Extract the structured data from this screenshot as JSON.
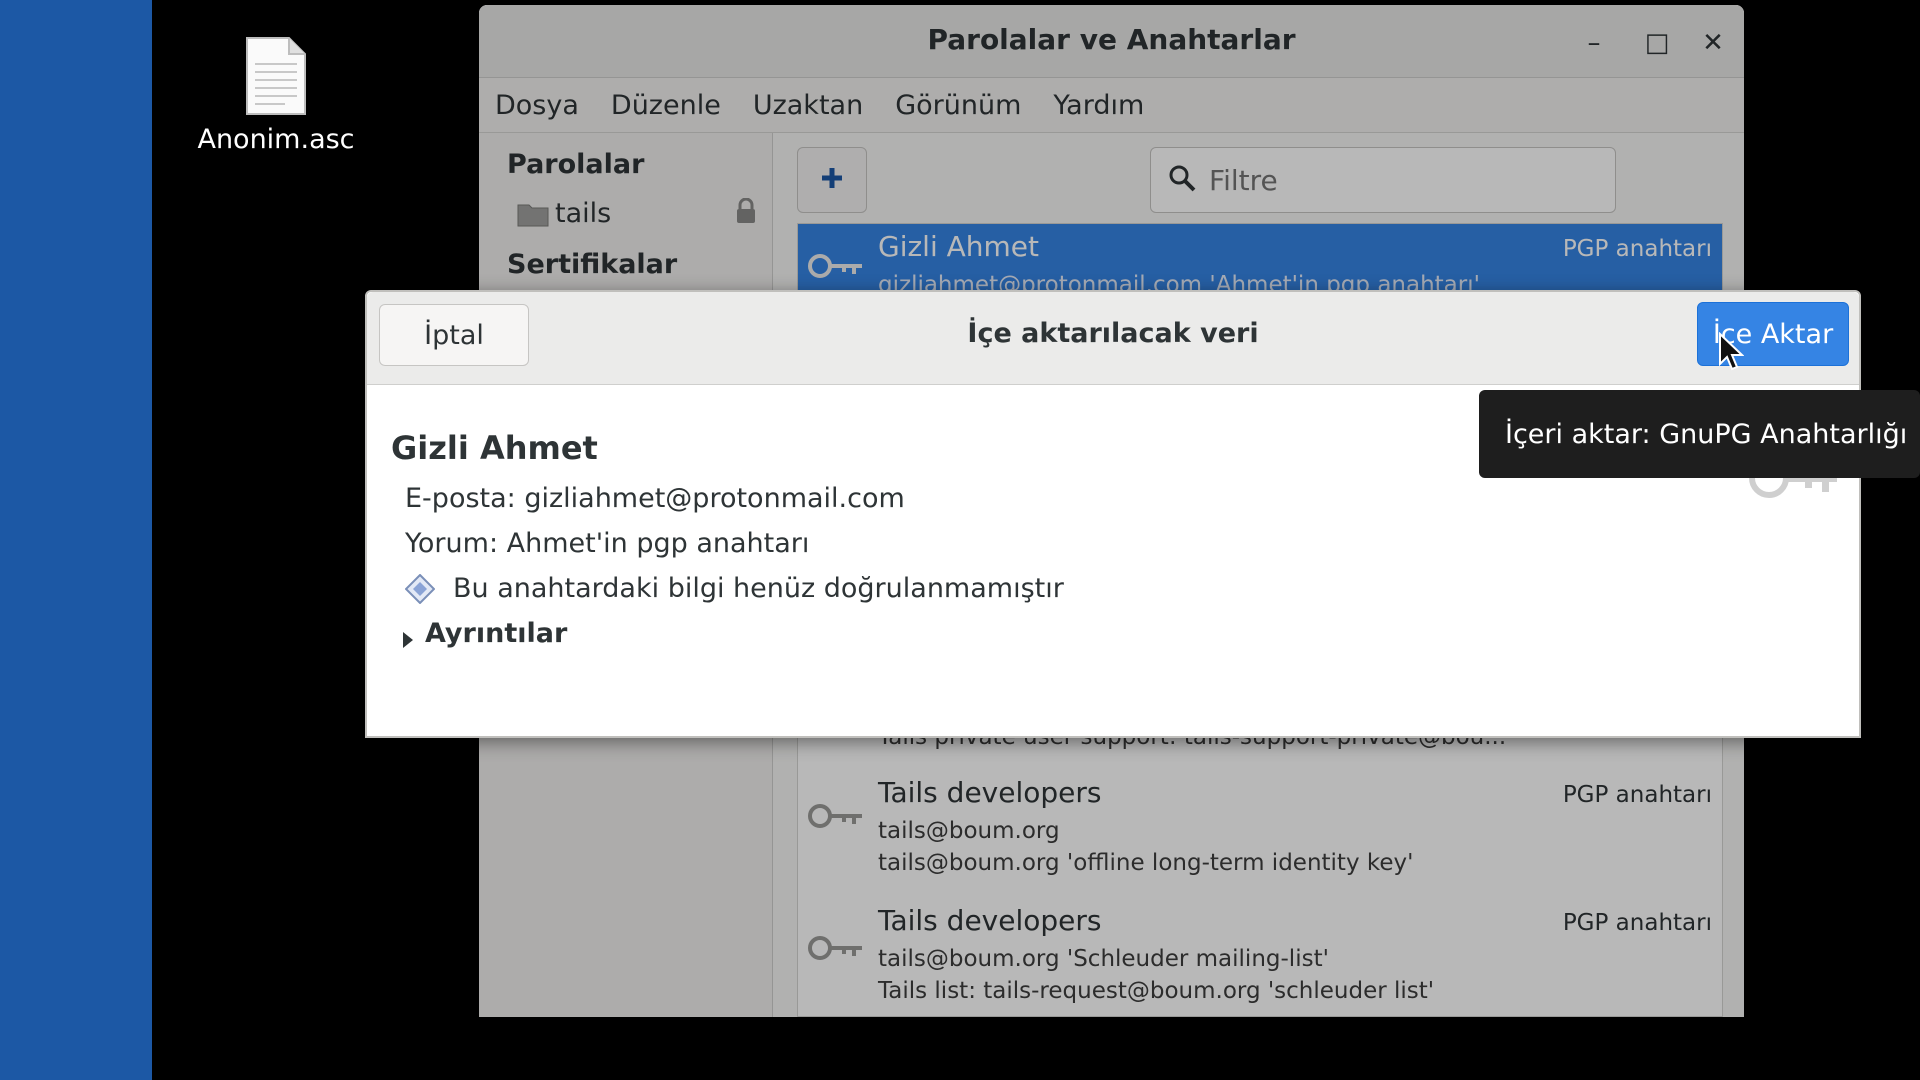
{
  "desktop": {
    "file_icon": "text-file-icon",
    "file_label": "Anonim.asc"
  },
  "window": {
    "title": "Parolalar ve Anahtarlar",
    "controls": {
      "minimize": "–",
      "maximize": "□",
      "close": "✕"
    },
    "menu": [
      "Dosya",
      "Düzenle",
      "Uzaktan",
      "Görünüm",
      "Yardım"
    ],
    "sidebar": {
      "passwords_heading": "Parolalar",
      "keyring_item": "tails",
      "certificates_heading": "Sertifikalar"
    },
    "filter_placeholder": "Filtre",
    "keys": [
      {
        "name": "Gizli Ahmet",
        "lines": [
          "gizliahmet@protonmail.com 'Ahmet'in pgp anahtarı'"
        ],
        "type": "PGP anahtarı",
        "selected": true
      },
      {
        "name": "",
        "lines": [
          "Tails private user support: tails-support-private@bou..."
        ],
        "type": ""
      },
      {
        "name": "Tails developers",
        "lines": [
          "tails@boum.org",
          "tails@boum.org 'offline long-term identity key'"
        ],
        "type": "PGP anahtarı"
      },
      {
        "name": "Tails developers",
        "lines": [
          "tails@boum.org 'Schleuder mailing-list'",
          "Tails list: tails-request@boum.org 'schleuder list'"
        ],
        "type": "PGP anahtarı"
      }
    ]
  },
  "dialog": {
    "cancel_label": "İptal",
    "title": "İçe aktarılacak veri",
    "import_label": "İçe Aktar",
    "key_holder": "Gizli Ahmet",
    "email_line": "E-posta: gizliahmet@protonmail.com",
    "comment_line": "Yorum: Ahmet'in pgp anahtarı",
    "validity_line": "Bu anahtardaki bilgi henüz doğrulanmamıştır",
    "details_label": "Ayrıntılar"
  },
  "tooltip": {
    "text": "İçeri aktar: GnuPG Anahtarlığı"
  },
  "colors": {
    "accent": "#3584e4",
    "desktop_blue": "#1c58a5",
    "tooltip_bg": "#1e1e1e"
  }
}
